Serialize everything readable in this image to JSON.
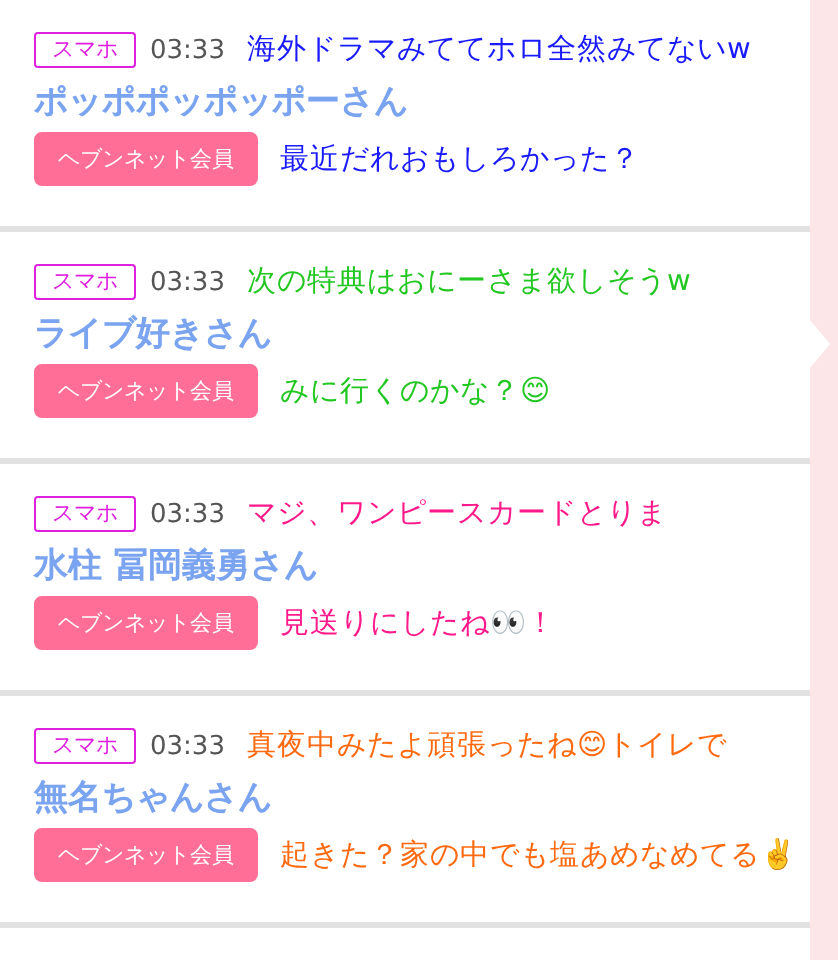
{
  "posts": [
    {
      "device": "スマホ",
      "time": "03:33",
      "name": "ポッポポッポッポーさん",
      "badge": "ヘブンネット会員",
      "caption": [
        "海外ドラマみててホロ全然みてないw",
        "最近だれおもしろかった？"
      ],
      "color": "#1a1aff"
    },
    {
      "device": "スマホ",
      "time": "03:33",
      "name": "ライブ好きさん",
      "badge": "ヘブンネット会員",
      "caption": [
        "次の特典はおにーさま欲しそうw",
        "みに行くのかな？😊"
      ],
      "color": "#22c722"
    },
    {
      "device": "スマホ",
      "time": "03:33",
      "name": "水柱 冨岡義勇さん",
      "badge": "ヘブンネット会員",
      "caption": [
        "マジ、ワンピースカードとりま",
        "見送りにしたね👀！"
      ],
      "color": "#ff1a8c"
    },
    {
      "device": "スマホ",
      "time": "03:33",
      "name": "無名ちゃんさん",
      "badge": "ヘブンネット会員",
      "caption": [
        "真夜中みたよ頑張ったね😊トイレで",
        "起きた？家の中でも塩あめなめてる✌️"
      ],
      "color": "#ff6a10"
    }
  ]
}
